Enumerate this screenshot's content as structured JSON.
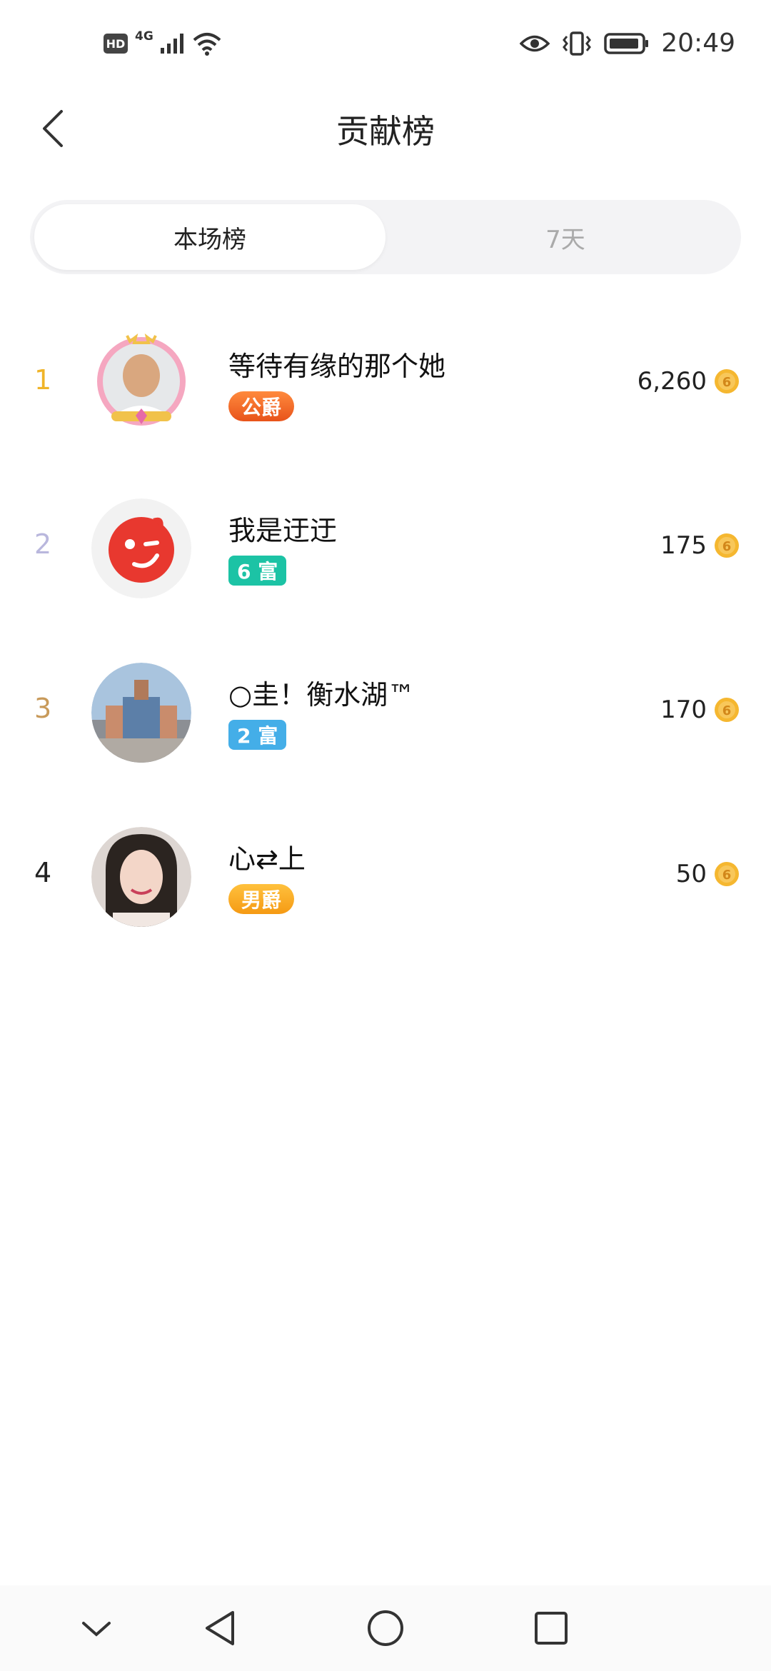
{
  "status_bar": {
    "hd": "HD",
    "network": "4G",
    "time": "20:49"
  },
  "header": {
    "title": "贡献榜"
  },
  "tabs": [
    {
      "label": "本场榜",
      "active": true
    },
    {
      "label": "7天",
      "active": false
    }
  ],
  "ranking": [
    {
      "rank": "1",
      "name": "等待有缘的那个她",
      "badge": "公爵",
      "score": "6,260",
      "rank_color": "#f0b429"
    },
    {
      "rank": "2",
      "name": "我是迂迂",
      "badge": "6 富",
      "score": "175",
      "rank_color": "#b9b7dd"
    },
    {
      "rank": "3",
      "name": "○圭！衡水湖™",
      "badge": "2 富",
      "score": "170",
      "rank_color": "#c89a5a"
    },
    {
      "rank": "4",
      "name": "心⇄上",
      "badge": "男爵",
      "score": "50",
      "rank_color": "#222222"
    }
  ],
  "colors": {
    "badge_gongjue": "#f26a21",
    "badge_fu6": "#1cc3a5",
    "badge_fu2": "#44aee8",
    "badge_nanjue": "#f7a421",
    "coin": "#f5b730"
  }
}
